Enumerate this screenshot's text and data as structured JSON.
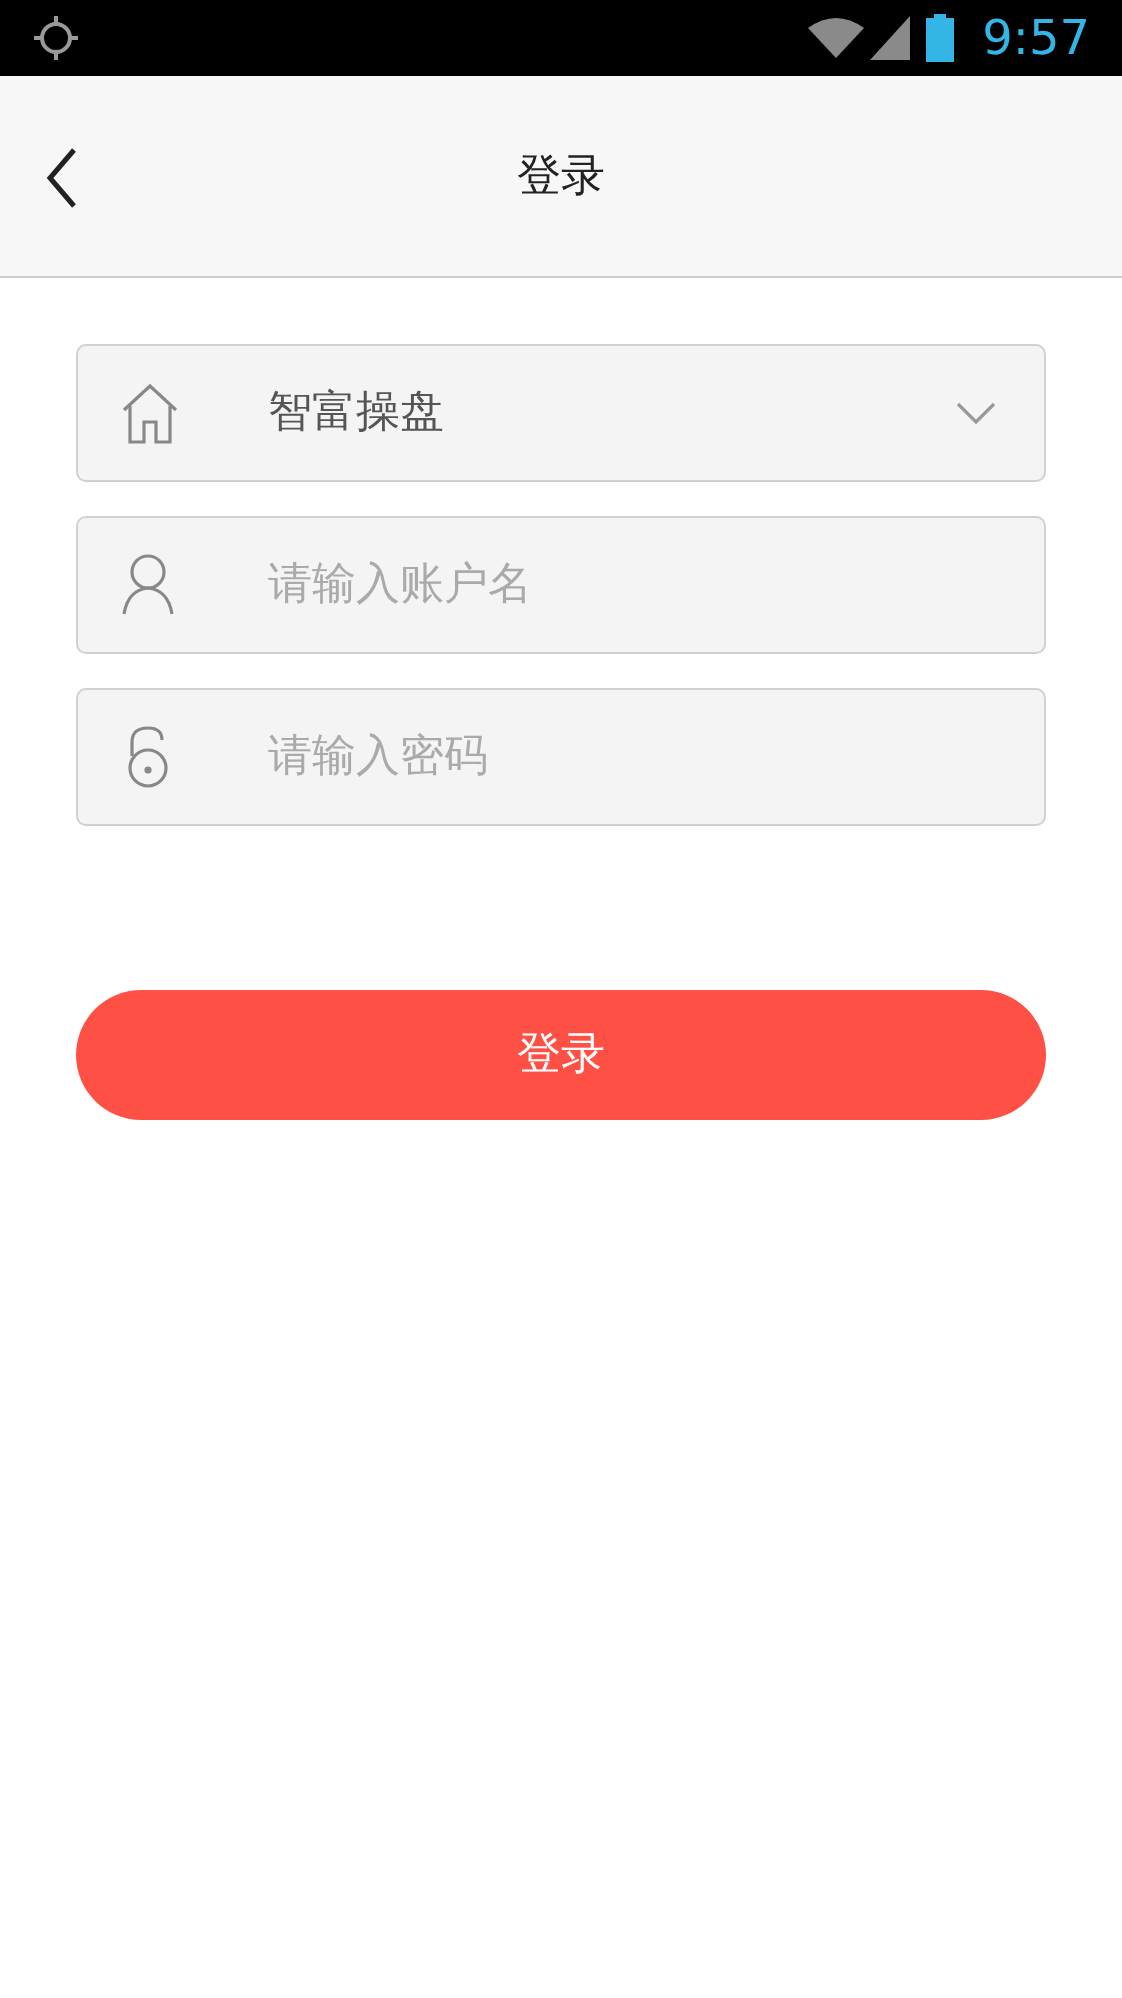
{
  "status_bar": {
    "time": "9:57"
  },
  "header": {
    "title": "登录"
  },
  "fields": [
    {
      "kind": "select",
      "value": "智富操盘"
    },
    {
      "kind": "username",
      "placeholder": "请输入账户名"
    },
    {
      "kind": "password",
      "placeholder": "请输入密码"
    }
  ],
  "login_button": {
    "label": "登录"
  }
}
